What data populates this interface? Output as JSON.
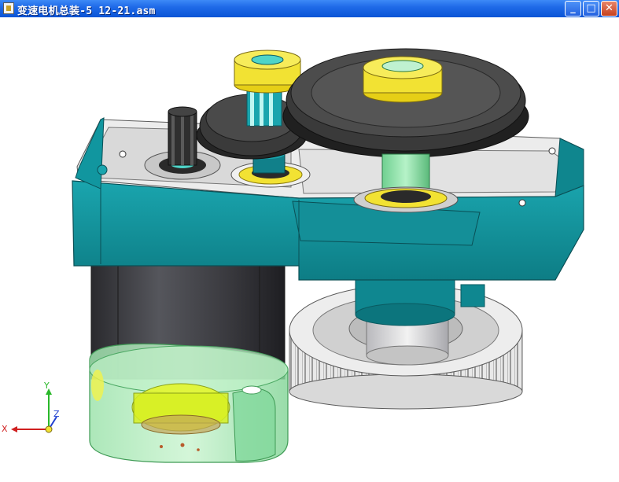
{
  "window": {
    "title": "变速电机总装-5  12-21.asm",
    "buttons": {
      "minimize": "_",
      "maximize": "□",
      "close": "✕"
    }
  },
  "triad": {
    "x_label": "X",
    "y_label": "Y",
    "z_label": "Z"
  },
  "colors": {
    "housing": "#14909a",
    "housing_dark": "#0e6d74",
    "gear_dark": "#2c2c2c",
    "bearing": "#f3e03a",
    "shaft": "#88e2a6",
    "motor_body": "#404045",
    "end_cap": "#a8eab6",
    "gear_silver": "#d6d6d6"
  }
}
